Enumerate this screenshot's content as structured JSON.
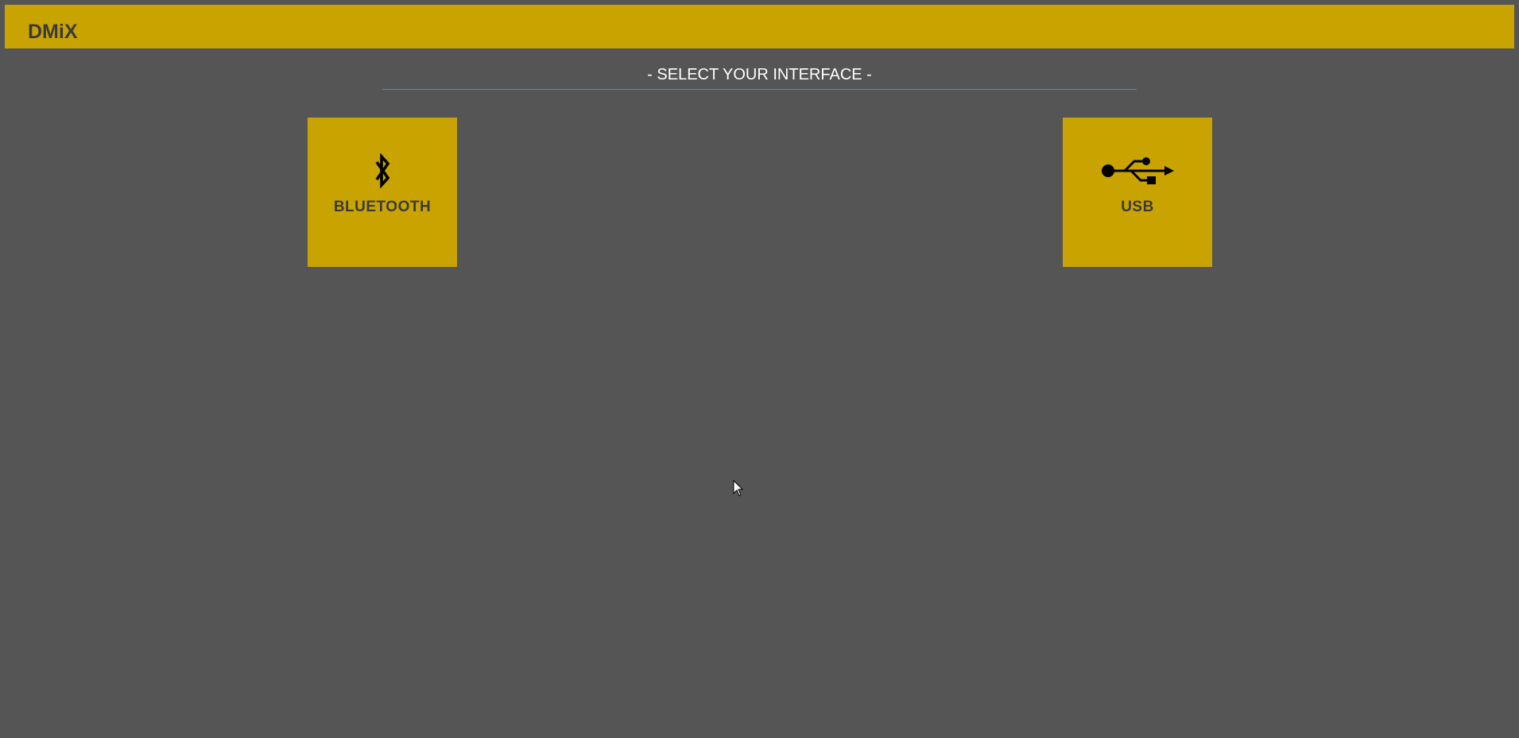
{
  "app": {
    "title": "DMiX"
  },
  "main": {
    "heading": "- SELECT YOUR INTERFACE -",
    "options": [
      {
        "label": "BLUETOOTH",
        "icon": "bluetooth-icon"
      },
      {
        "label": "USB",
        "icon": "usb-icon"
      }
    ]
  },
  "colors": {
    "background": "#555555",
    "accent": "#C9A300",
    "divider": "#1FA4C6",
    "tile_text": "#3A3A3A",
    "heading_text": "#FFFFFF"
  }
}
